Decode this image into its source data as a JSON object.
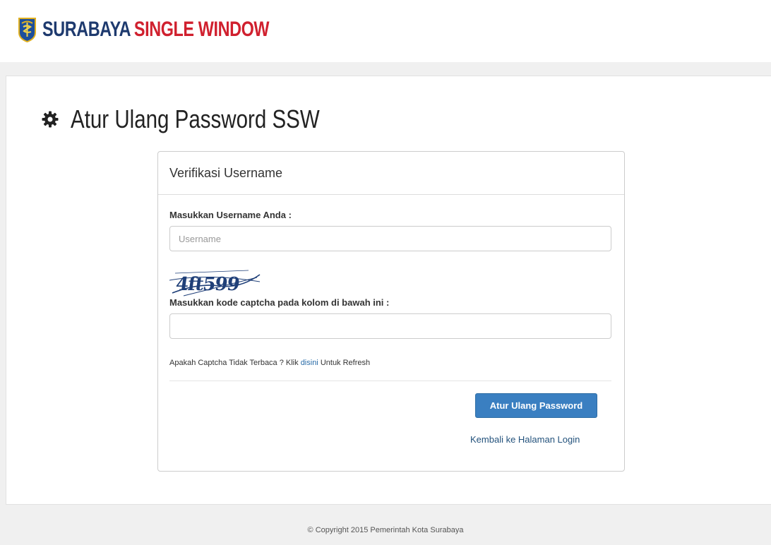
{
  "header": {
    "brand_part1": "SURABAYA",
    "brand_part2": "SINGLE WINDOW",
    "brand_color_primary": "#1e3a6e",
    "brand_color_accent": "#d0202e",
    "emblem_icon": "surabaya-emblem-icon"
  },
  "page": {
    "title": "Atur Ulang Password SSW",
    "title_icon": "gear-icon"
  },
  "panel": {
    "heading": "Verifikasi Username",
    "username_label": "Masukkan Username Anda :",
    "username_value": "",
    "username_placeholder": "Username",
    "captcha_text": "4ft599",
    "captcha_label": "Masukkan kode captcha pada kolom di bawah ini :",
    "captcha_value": "",
    "captcha_placeholder": "",
    "hint_before": "Apakah Captcha Tidak Terbaca ? Klik ",
    "hint_link": "disini",
    "hint_after": " Untuk Refresh",
    "submit_label": "Atur Ulang Password",
    "submit_color": "#3a7fc1",
    "back_link": "Kembali ke Halaman Login"
  },
  "footer": {
    "copyright": "© Copyright 2015 Pemerintah Kota Surabaya"
  }
}
